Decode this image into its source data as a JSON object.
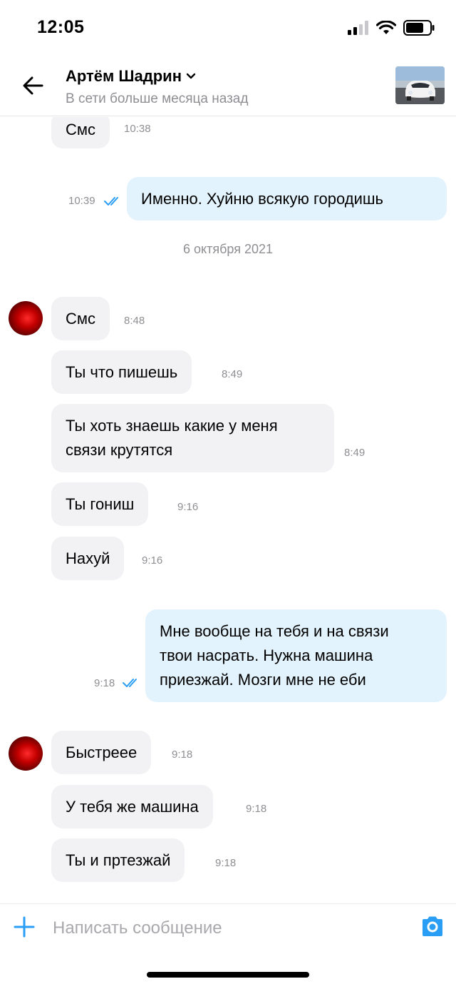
{
  "status_bar": {
    "time": "12:05"
  },
  "header": {
    "contact_name": "Артём Шадрин",
    "contact_status": "В сети больше месяца назад"
  },
  "messages": [
    {
      "dir": "in",
      "text": "Смс",
      "time": "10:38"
    },
    {
      "dir": "out",
      "text": "Именно. Хуйню всякую городишь",
      "time": "10:39",
      "read": true
    },
    {
      "dir": "in",
      "text": "Смс",
      "time": "8:48"
    },
    {
      "dir": "in",
      "text": "Ты что пишешь",
      "time": "8:49"
    },
    {
      "dir": "in",
      "text": "Ты хоть знаешь какие у меня\nсвязи   крутятся",
      "time": "8:49"
    },
    {
      "dir": "in",
      "text": "Ты  гониш",
      "time": "9:16"
    },
    {
      "dir": "in",
      "text": "Нахуй",
      "time": "9:16"
    },
    {
      "dir": "out",
      "text": "Мне вообще на тебя и на связи\nтвои насрать. Нужна машина\nприезжай. Мозги мне не еби",
      "time": "9:18",
      "read": true
    },
    {
      "dir": "in",
      "text": "Быстреее",
      "time": "9:18"
    },
    {
      "dir": "in",
      "text": "У тебя же машина",
      "time": "9:18"
    },
    {
      "dir": "in",
      "text": "Ты и пртезжай",
      "time": "9:18"
    }
  ],
  "date_separator": "6 октября 2021",
  "composer": {
    "placeholder": "Написать сообщение"
  },
  "colors": {
    "accent": "#2a9df4",
    "incoming_bubble": "#f2f2f4",
    "outgoing_bubble": "#e3f3fd",
    "meta_text": "#8e8e93"
  },
  "icons": {
    "back": "arrow-left-icon",
    "dropdown": "chevron-down-icon",
    "read_receipt": "double-check-icon",
    "attach": "plus-icon",
    "camera": "camera-icon"
  }
}
